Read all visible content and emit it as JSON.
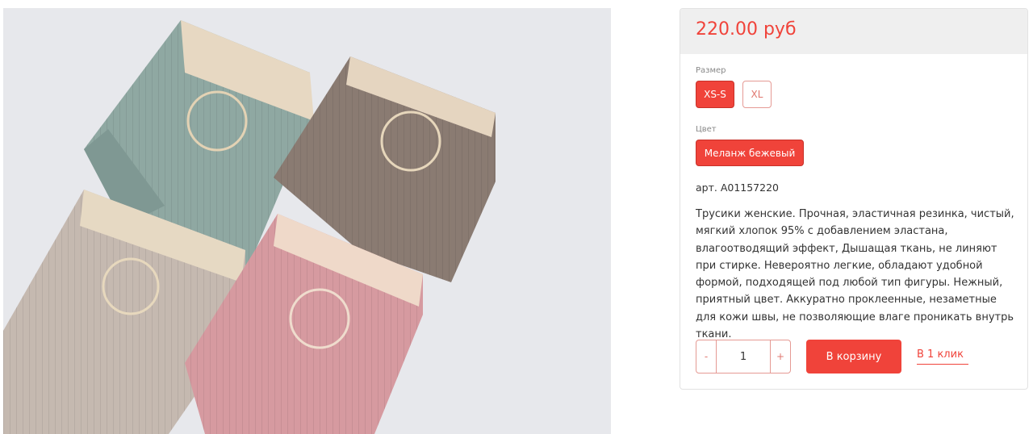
{
  "product": {
    "price": "220.00 руб",
    "size_label": "Размер",
    "sizes": [
      {
        "label": "XS-S",
        "selected": true
      },
      {
        "label": "XL",
        "selected": false
      }
    ],
    "color_label": "Цвет",
    "color_value": "Меланж бежевый",
    "article": "арт. A01157220",
    "description": "Трусики женские. Прочная, эластичная резинка, чистый, мягкий хлопок 95% с добавлением эластана, влагоотводящий эффект, Дышащая ткань, не линяют при стирке. Невероятно легкие, обладают удобной формой, подходящей под любой тип фигуры. Нежный, приятный цвет. Аккуратно проклеенные, незаметные для кожи швы, не позволяющие влаге проникать внутрь ткани."
  },
  "cart": {
    "minus": "-",
    "quantity": "1",
    "plus": "+",
    "add_to_cart": "В корзину",
    "one_click": "В 1 клик"
  },
  "colors": {
    "accent": "#f0433a",
    "price_bar_bg": "#efefef",
    "photo_bg": "#e7e8ec"
  }
}
